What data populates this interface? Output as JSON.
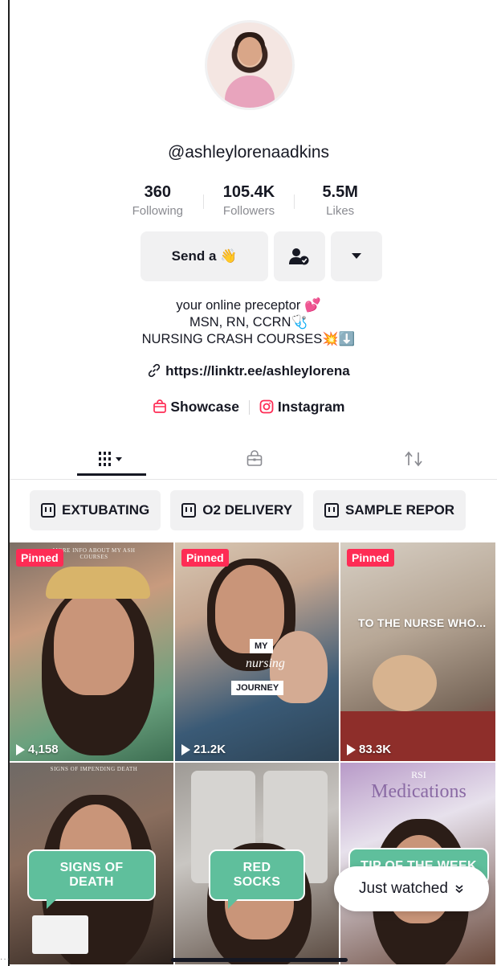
{
  "profile": {
    "username": "@ashleylorenaadkins",
    "stats": [
      {
        "value": "360",
        "label": "Following"
      },
      {
        "value": "105.4K",
        "label": "Followers"
      },
      {
        "value": "5.5M",
        "label": "Likes"
      }
    ],
    "buttons": {
      "send_label": "Send a",
      "send_emoji": "👋",
      "follow_icon": "person-check-icon",
      "dropdown_icon": "caret-down-icon"
    },
    "bio": {
      "line1": "your online preceptor 💕",
      "line2": "MSN, RN, CCRN🩺",
      "line3": "NURSING CRASH COURSES💥⬇️"
    },
    "link": "https://linktr.ee/ashleylorena",
    "showcase_label": "Showcase",
    "instagram_label": "Instagram"
  },
  "tabs": [
    {
      "icon": "grid-icon",
      "label": "⁞⁞⁞ ▾"
    },
    {
      "icon": "lock-bag-icon",
      "label": "🔒"
    },
    {
      "icon": "repost-icon",
      "label": "⇅"
    }
  ],
  "playlists": [
    "EXTUBATING",
    "O2 DELIVERY",
    "SAMPLE REPOR"
  ],
  "videos": [
    {
      "pinned": "Pinned",
      "views": "4,158",
      "caption": "MORE INFO ABOUT MY ASH COURSES"
    },
    {
      "pinned": "Pinned",
      "views": "21.2K",
      "tag_top": "MY",
      "tag_mid": "nursing",
      "tag_bottom": "JOURNEY"
    },
    {
      "pinned": "Pinned",
      "views": "83.3K",
      "caption": "TO THE NURSE WHO..."
    },
    {
      "caption_small": "SIGNS OF IMPENDING DEATH",
      "bubble": "SIGNS OF DEATH"
    },
    {
      "bubble": "RED SOCKS"
    },
    {
      "title_small": "RSI",
      "title": "Medications",
      "bubble": "TIP OF THE WEEK"
    }
  ],
  "just_watched": "Just watched",
  "colors": {
    "accent": "#fe2c55",
    "bubble": "#5fbf9c",
    "text": "#161823",
    "muted": "#8a8b91"
  }
}
